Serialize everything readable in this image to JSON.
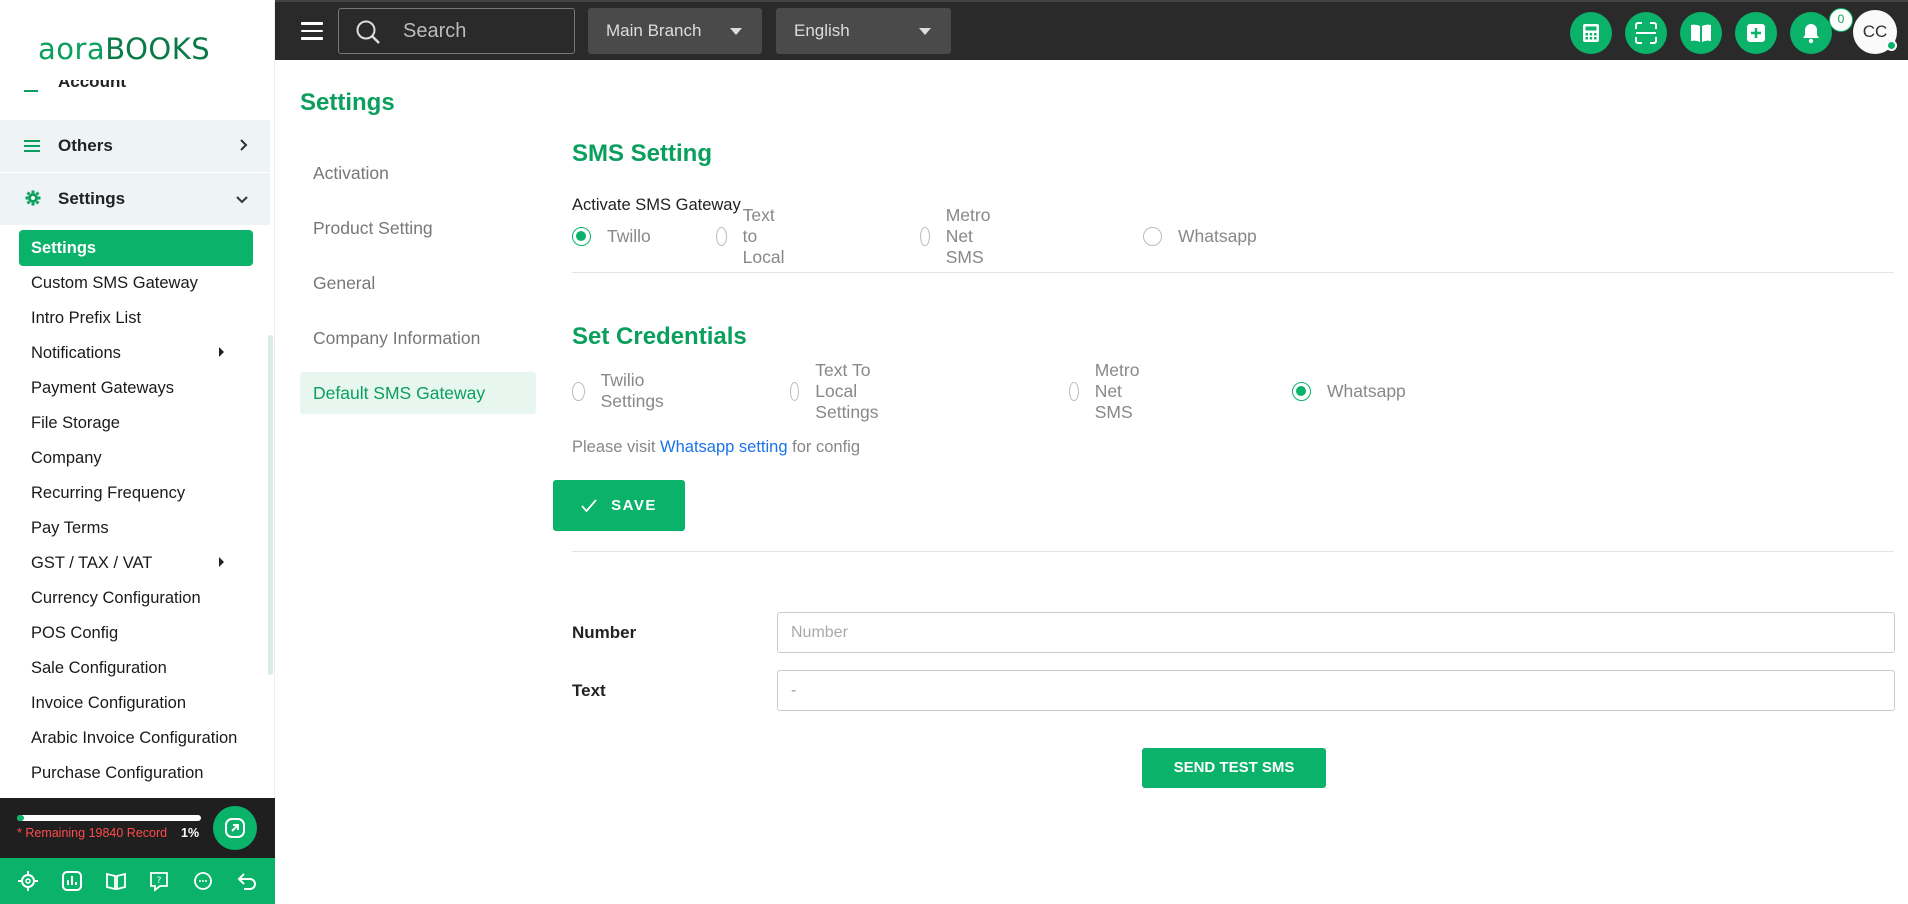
{
  "logo": {
    "part1": "aora",
    "part2": "BOOKS"
  },
  "sidebar": {
    "cut_item": "Account",
    "others_label": "Others",
    "settings_label": "Settings",
    "items": [
      {
        "label": "Settings",
        "active": true
      },
      {
        "label": "Custom SMS Gateway"
      },
      {
        "label": "Intro Prefix List"
      },
      {
        "label": "Notifications",
        "arrow": true
      },
      {
        "label": "Payment Gateways"
      },
      {
        "label": "File Storage"
      },
      {
        "label": "Company"
      },
      {
        "label": "Recurring Frequency"
      },
      {
        "label": "Pay Terms"
      },
      {
        "label": "GST / TAX / VAT",
        "arrow": true
      },
      {
        "label": "Currency Configuration"
      },
      {
        "label": "POS Config"
      },
      {
        "label": "Sale Configuration"
      },
      {
        "label": "Invoice Configuration"
      },
      {
        "label": "Arabic Invoice Configuration"
      },
      {
        "label": "Purchase Configuration"
      }
    ],
    "footer": {
      "remaining_text": "* Remaining 19840 Record",
      "percent_text": "1%",
      "progress": 0.01
    },
    "bottom_icons": [
      "gear-icon",
      "chart-icon",
      "book-icon",
      "help-icon",
      "chat-icon",
      "back-icon"
    ]
  },
  "topbar": {
    "search_placeholder": "Search",
    "branch": "Main Branch",
    "language": "English",
    "notification_count": "0",
    "avatar_initials": "CC",
    "icons": [
      "calculator-icon",
      "scan-icon",
      "book-open-icon",
      "plus-square-icon",
      "bell-icon"
    ]
  },
  "page": {
    "title": "Settings",
    "left_nav": [
      {
        "label": "Activation"
      },
      {
        "label": "Product Setting"
      },
      {
        "label": "General"
      },
      {
        "label": "Company Information"
      },
      {
        "label": "Default SMS Gateway",
        "active": true
      }
    ]
  },
  "sms": {
    "title": "SMS Setting",
    "activate_label": "Activate SMS Gateway",
    "gateway_options": [
      {
        "label": "Twillo",
        "checked": true
      },
      {
        "label": "Text to Local"
      },
      {
        "label": "Metro Net SMS"
      },
      {
        "label": "Whatsapp"
      }
    ],
    "cred_title": "Set Credentials",
    "cred_options": [
      {
        "label": "Twilio Settings"
      },
      {
        "label": "Text To Local Settings"
      },
      {
        "label": "Metro Net SMS"
      },
      {
        "label": "Whatsapp",
        "checked": true
      }
    ],
    "note_prefix": "Please visit",
    "note_link": "Whatsapp setting",
    "note_suffix": "for config",
    "save_label": "SAVE",
    "number_label": "Number",
    "number_placeholder": "Number",
    "text_label": "Text",
    "text_value": "-",
    "send_test_label": "SEND TEST SMS"
  },
  "colors": {
    "accent": "#0ab26a",
    "topbar": "#2a2a2a",
    "link": "#1a73e8"
  }
}
